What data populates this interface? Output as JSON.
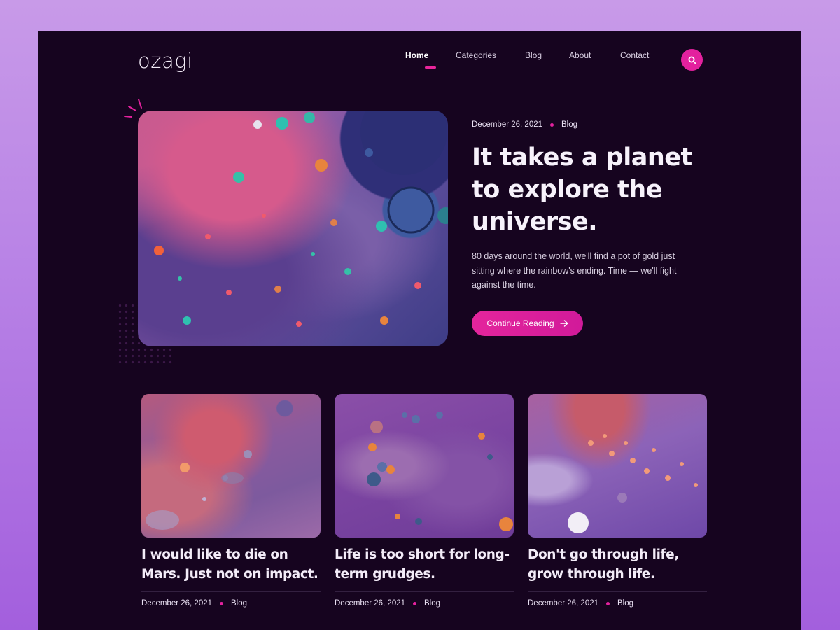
{
  "brand": {
    "logo": "ozagi"
  },
  "nav": {
    "items": [
      {
        "label": "Home",
        "active": true
      },
      {
        "label": "Categories",
        "active": false
      },
      {
        "label": "Blog",
        "active": false
      },
      {
        "label": "About",
        "active": false
      },
      {
        "label": "Contact",
        "active": false
      }
    ],
    "search_icon": "search-icon"
  },
  "hero": {
    "date": "December 26, 2021",
    "category": "Blog",
    "title": "It takes a planet to explore the universe.",
    "description": "80 days around the world, we'll find a pot of gold just sitting where the rainbow's ending. Time — we'll fight against the time.",
    "cta_label": "Continue Reading",
    "cta_icon": "arrow-right-icon"
  },
  "posts": [
    {
      "title": "I would like to die on Mars. Just not on impact.",
      "date": "December 26, 2021",
      "category": "Blog"
    },
    {
      "title": "Life is too short for long-term grudges.",
      "date": "December 26, 2021",
      "category": "Blog"
    },
    {
      "title": "Don't go through life, grow through life.",
      "date": "December 26, 2021",
      "category": "Blog"
    }
  ],
  "colors": {
    "background": "#16041f",
    "accent": "#e3219e",
    "page_gradient_top": "#c89ae8",
    "page_gradient_bottom": "#a35fdd"
  }
}
